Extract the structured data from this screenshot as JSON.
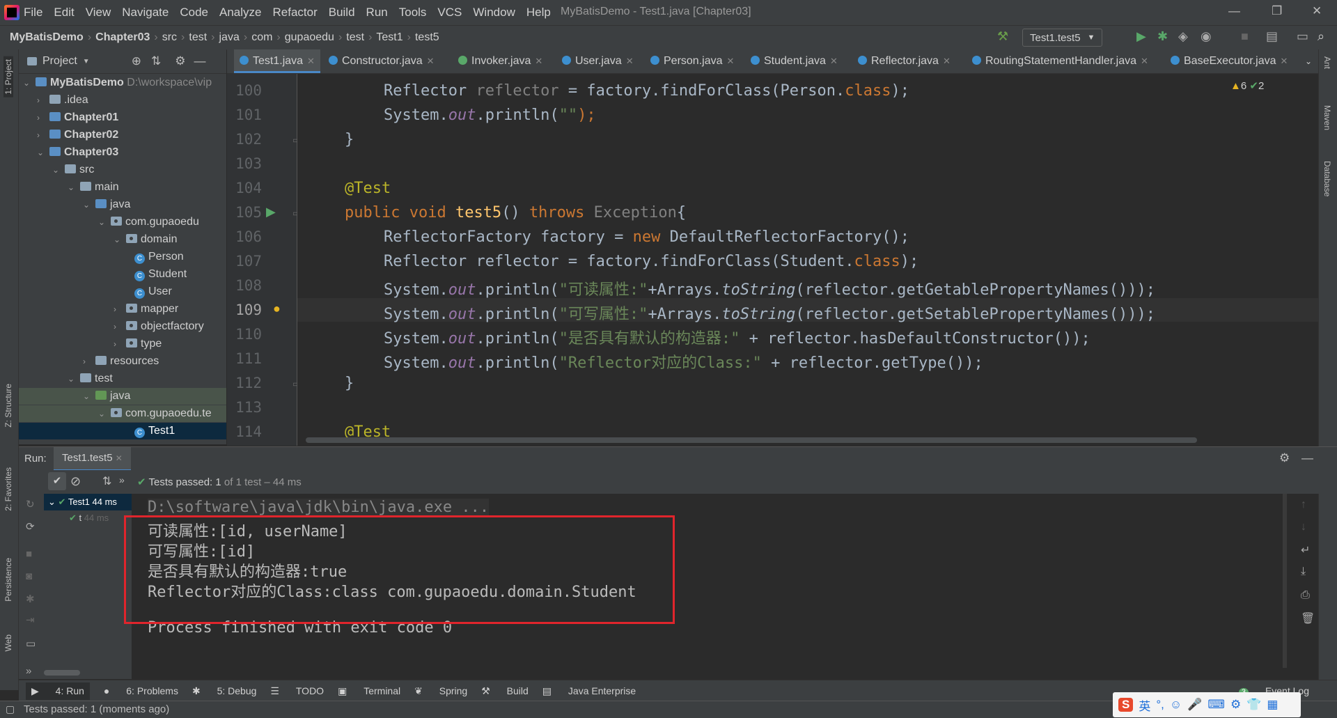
{
  "menu": [
    "File",
    "Edit",
    "View",
    "Navigate",
    "Code",
    "Analyze",
    "Refactor",
    "Build",
    "Run",
    "Tools",
    "VCS",
    "Window",
    "Help"
  ],
  "window_title": "MyBatisDemo - Test1.java [Chapter03]",
  "breadcrumbs": [
    "MyBatisDemo",
    "Chapter03",
    "src",
    "test",
    "java",
    "com",
    "gupaoedu",
    "test",
    "Test1",
    "test5"
  ],
  "run_config": "Test1.test5",
  "project": {
    "header": "Project",
    "tree": [
      {
        "label": "MyBatisDemo",
        "extra": "D:\\workspace\\vip"
      },
      {
        "label": ".idea"
      },
      {
        "label": "Chapter01"
      },
      {
        "label": "Chapter02"
      },
      {
        "label": "Chapter03"
      },
      {
        "label": "src"
      },
      {
        "label": "main"
      },
      {
        "label": "java"
      },
      {
        "label": "com.gupaoedu"
      },
      {
        "label": "domain"
      },
      {
        "label": "Person"
      },
      {
        "label": "Student"
      },
      {
        "label": "User"
      },
      {
        "label": "mapper"
      },
      {
        "label": "objectfactory"
      },
      {
        "label": "type"
      },
      {
        "label": "resources"
      },
      {
        "label": "test"
      },
      {
        "label": "java"
      },
      {
        "label": "com.gupaoedu.te"
      },
      {
        "label": "Test1"
      }
    ]
  },
  "tabs": [
    "Test1.java",
    "Constructor.java",
    "Invoker.java",
    "User.java",
    "Person.java",
    "Student.java",
    "Reflector.java",
    "RoutingStatementHandler.java",
    "BaseExecutor.java"
  ],
  "inspections": {
    "warnings": "6",
    "ok": "2"
  },
  "line_numbers": [
    "100",
    "101",
    "102",
    "103",
    "104",
    "105",
    "106",
    "107",
    "108",
    "109",
    "110",
    "111",
    "112",
    "113",
    "114"
  ],
  "code": {
    "l100a": "Reflector ",
    "l100b": "reflector",
    "l100c": " = factory.findForClass(Person.",
    "l100d": "class",
    "l100e": ");",
    "l101a": "System.",
    "l101b": "out",
    "l101c": ".println(",
    "l101d": "\"\"",
    "l101e": ");",
    "l102": "}",
    "l104": "@Test",
    "l105a": "public void ",
    "l105b": "test5",
    "l105c": "() ",
    "l105d": "throws ",
    "l105e": "Exception",
    "l105f": "{",
    "l106a": "ReflectorFactory factory = ",
    "l106b": "new ",
    "l106c": "DefaultReflectorFactory();",
    "l107a": "Reflector reflector = factory.findForClass(Student.",
    "l107b": "class",
    "l107c": ");",
    "l108a": "System.",
    "l108b": "out",
    "l108c": ".println(",
    "l108d": "\"可读属性:\"",
    "l108e": "+Arrays.",
    "l108f": "toString",
    "l108g": "(reflector.getGetablePropertyNames()));",
    "l109a": "System.",
    "l109b": "out",
    "l109c": ".println(",
    "l109d": "\"可写属性:\"",
    "l109e": "+Arrays.",
    "l109f": "toString",
    "l109g": "(reflector.getSetablePropertyNames()));",
    "l110a": "System.",
    "l110b": "out",
    "l110c": ".println(",
    "l110d": "\"是否具有默认的构造器:\"",
    "l110e": " + reflector.hasDefaultConstructor());",
    "l111a": "System.",
    "l111b": "out",
    "l111c": ".println(",
    "l111d": "\"Reflector对应的Class:\"",
    "l111e": " + reflector.getType());",
    "l112": "}",
    "l114": "@Test"
  },
  "run": {
    "label": "Run:",
    "tab": "Test1.test5",
    "status": "Tests passed:",
    "status_count": "1",
    "status_rest": "of 1 test – 44 ms",
    "tree_root": "Test1",
    "tree_root_time": "44 ms",
    "tree_child": "t",
    "tree_child_time": "44 ms"
  },
  "console": [
    "D:\\software\\java\\jdk\\bin\\java.exe ...",
    "可读属性:[id, userName]",
    "可写属性:[id]",
    "是否具有默认的构造器:true",
    "Reflector对应的Class:class com.gupaoedu.domain.Student",
    "Process finished with exit code 0"
  ],
  "bottom_tools": [
    "4: Run",
    "6: Problems",
    "5: Debug",
    "TODO",
    "Terminal",
    "Spring",
    "Build",
    "Java Enterprise"
  ],
  "event_log": "Event Log",
  "event_log_count": "3",
  "status_text": "Tests passed: 1 (moments ago)",
  "left_strip": [
    "1: Project",
    "Z: Structure",
    "2: Favorites",
    "Persistence",
    "Web"
  ],
  "right_strip": [
    "Ant",
    "Maven",
    "Database"
  ],
  "ime": "英"
}
